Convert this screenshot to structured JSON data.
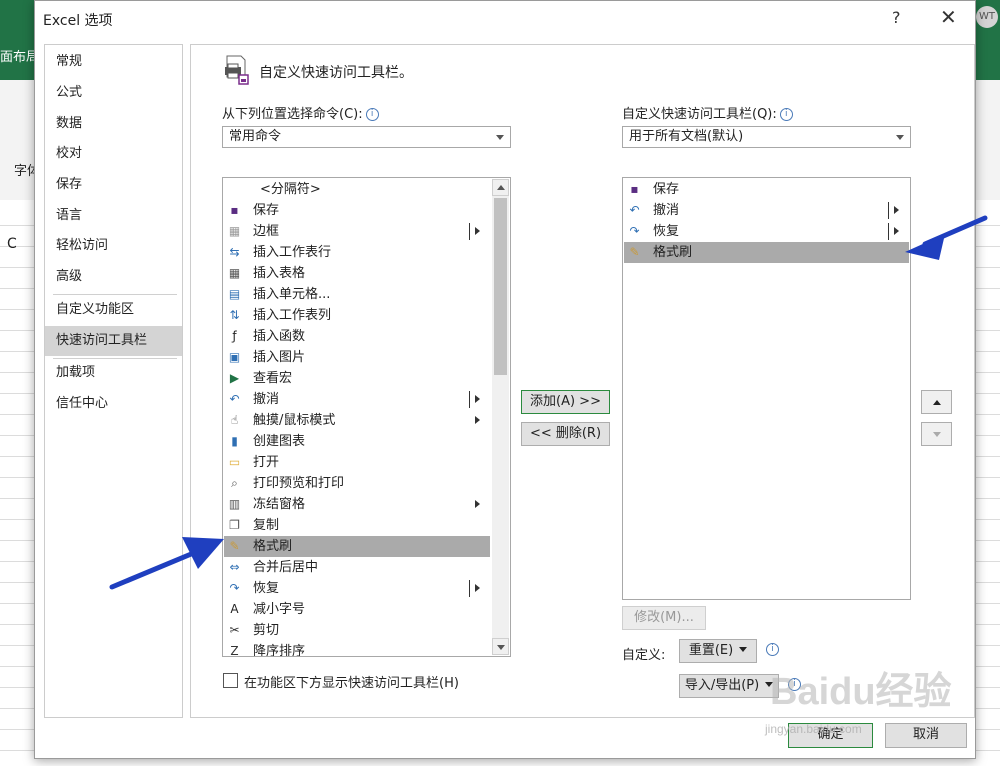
{
  "background": {
    "ribbon_tab": "面布局",
    "ziti": "字体",
    "column_c": "C",
    "avatar": "WT"
  },
  "dialog": {
    "title": "Excel 选项",
    "help": "?",
    "close": "✕"
  },
  "nav": {
    "items": [
      {
        "label": "常规"
      },
      {
        "label": "公式"
      },
      {
        "label": "数据"
      },
      {
        "label": "校对"
      },
      {
        "label": "保存"
      },
      {
        "label": "语言"
      },
      {
        "label": "轻松访问"
      },
      {
        "label": "高级"
      },
      {
        "label": "自定义功能区"
      },
      {
        "label": "快速访问工具栏"
      },
      {
        "label": "加载项"
      },
      {
        "label": "信任中心"
      }
    ]
  },
  "header": {
    "title": "自定义快速访问工具栏。"
  },
  "left": {
    "choose_label": "从下列位置选择命令(C):",
    "choose_value": "常用命令",
    "commands": [
      {
        "label": "<分隔符>",
        "icon": ""
      },
      {
        "label": "保存",
        "icon": "save-icon"
      },
      {
        "label": "边框",
        "icon": "border-icon"
      },
      {
        "label": "插入工作表行",
        "icon": "insert-row-icon"
      },
      {
        "label": "插入表格",
        "icon": "table-icon"
      },
      {
        "label": "插入单元格...",
        "icon": "insert-cells-icon"
      },
      {
        "label": "插入工作表列",
        "icon": "insert-column-icon"
      },
      {
        "label": "插入函数",
        "icon": "function-icon"
      },
      {
        "label": "插入图片",
        "icon": "picture-icon"
      },
      {
        "label": "查看宏",
        "icon": "macro-icon"
      },
      {
        "label": "撤消",
        "icon": "undo-icon"
      },
      {
        "label": "触摸/鼠标模式",
        "icon": "touch-icon"
      },
      {
        "label": "创建图表",
        "icon": "chart-icon"
      },
      {
        "label": "打开",
        "icon": "folder-icon"
      },
      {
        "label": "打印预览和打印",
        "icon": "print-preview-icon"
      },
      {
        "label": "冻结窗格",
        "icon": "freeze-icon"
      },
      {
        "label": "复制",
        "icon": "copy-icon"
      },
      {
        "label": "格式刷",
        "icon": "format-painter-icon"
      },
      {
        "label": "合并后居中",
        "icon": "merge-icon"
      },
      {
        "label": "恢复",
        "icon": "redo-icon"
      },
      {
        "label": "减小字号",
        "icon": "font-decrease-icon"
      },
      {
        "label": "剪切",
        "icon": "cut-icon"
      },
      {
        "label": "降序排序",
        "icon": "sort-icon"
      }
    ],
    "checkbox_label": "在功能区下方显示快速访问工具栏(H)"
  },
  "middle": {
    "add": "添加(A) >>",
    "remove": "<< 删除(R)"
  },
  "right": {
    "customize_label": "自定义快速访问工具栏(Q):",
    "customize_value": "用于所有文档(默认)",
    "items": [
      {
        "label": "保存",
        "icon": "save-icon"
      },
      {
        "label": "撤消",
        "icon": "undo-icon"
      },
      {
        "label": "恢复",
        "icon": "redo-icon"
      },
      {
        "label": "格式刷",
        "icon": "format-painter-icon"
      }
    ],
    "modify": "修改(M)...",
    "custom_label": "自定义:",
    "reset": "重置(E)",
    "import_export": "导入/导出(P)"
  },
  "footer": {
    "ok": "确定",
    "cancel": "取消"
  },
  "watermark": {
    "brand": "Baidu经验",
    "url": "jingyan.baidu.com"
  },
  "colors": {
    "excel_green": "#217346",
    "selection": "#aaaaaa",
    "arrow": "#1f3fbf"
  }
}
